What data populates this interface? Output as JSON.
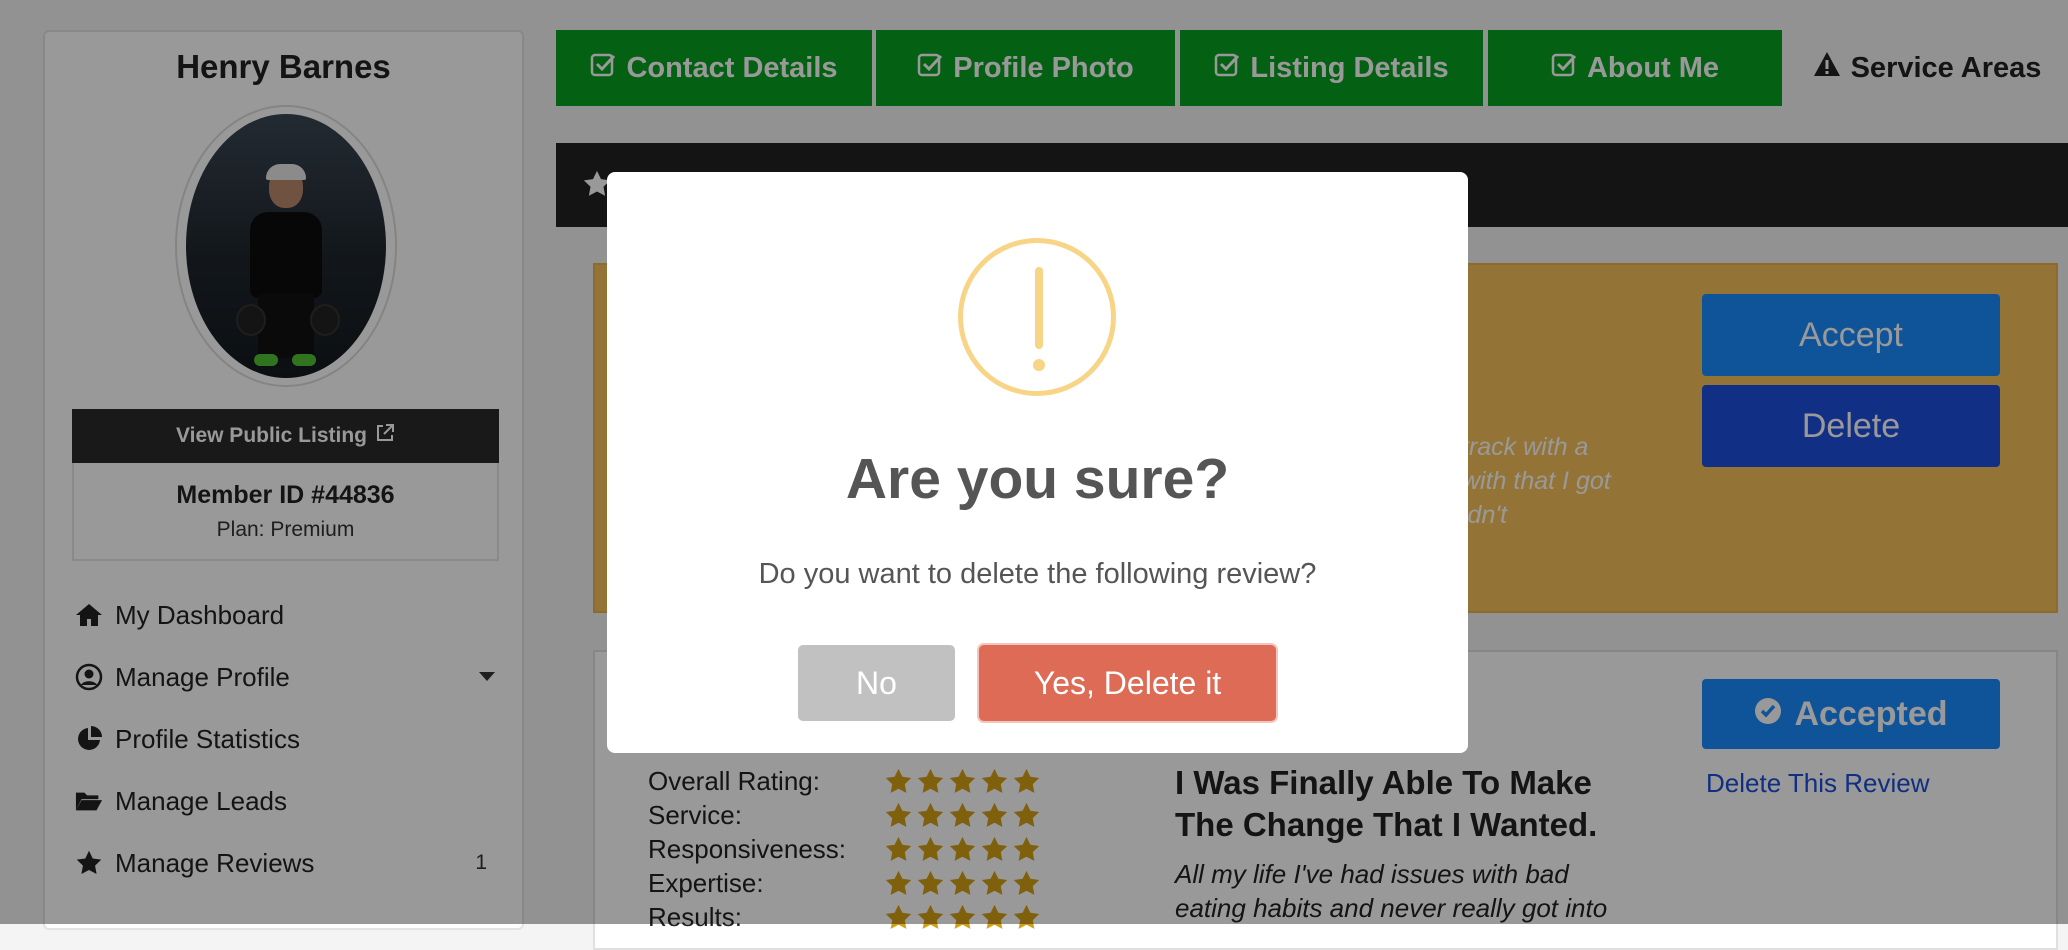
{
  "sidebar": {
    "user_name": "Henry Barnes",
    "view_listing_label": "View Public Listing",
    "member_id": "Member ID #44836",
    "plan": "Plan: Premium",
    "menu": [
      {
        "label": "My Dashboard",
        "icon": "home-icon"
      },
      {
        "label": "Manage Profile",
        "icon": "user-circle-icon"
      },
      {
        "label": "Profile Statistics",
        "icon": "pie-chart-icon"
      },
      {
        "label": "Manage Leads",
        "icon": "folder-open-icon"
      },
      {
        "label": "Manage Reviews",
        "icon": "star-icon",
        "count": "1"
      }
    ]
  },
  "tabs": [
    {
      "label": "Contact Details",
      "status": "complete"
    },
    {
      "label": "Profile Photo",
      "status": "complete"
    },
    {
      "label": "Listing Details",
      "status": "complete"
    },
    {
      "label": "About Me",
      "status": "complete"
    },
    {
      "label": "Service Areas",
      "status": "warning"
    }
  ],
  "pending_review": {
    "partial_text": [
      "track with a",
      "with that I got",
      "ldn't"
    ],
    "accept_label": "Accept",
    "delete_label": "Delete"
  },
  "review": {
    "ratings": [
      {
        "label": "Overall Rating:",
        "stars": 5
      },
      {
        "label": "Service:",
        "stars": 5
      },
      {
        "label": "Responsiveness:",
        "stars": 5
      },
      {
        "label": "Expertise:",
        "stars": 5
      },
      {
        "label": "Results:",
        "stars": 5
      }
    ],
    "title": "I Was Finally Able To Make The Change That I Wanted.",
    "body": "All my life I've had issues with bad eating habits and never really got into",
    "status_label": "Accepted",
    "delete_link": "Delete This Review"
  },
  "modal": {
    "title": "Are you sure?",
    "text": "Do you want to delete the following review?",
    "no_label": "No",
    "yes_label": "Yes, Delete it"
  },
  "colors": {
    "tab_complete": "#08a020",
    "accent_blue": "#1a8cff",
    "delete_blue": "#1f4fe0",
    "star_gold": "#d4a017",
    "modal_warning": "#f8d486",
    "confirm_red": "#dd6b55"
  }
}
